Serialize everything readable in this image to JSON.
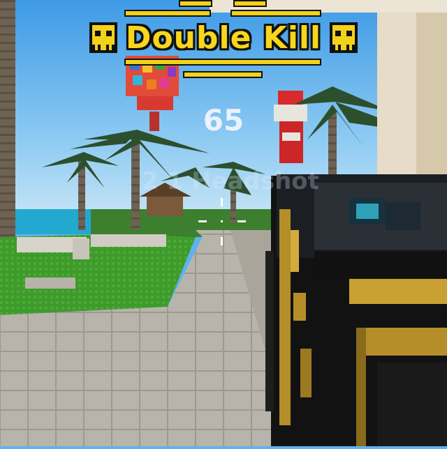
{
  "hud": {
    "kill_banner": "Double Kill",
    "score_popup": "65",
    "faded_label": "2 1 Headshot",
    "banner_color": "#f7d61c",
    "banner_outline": "#111111",
    "banner_icons": [
      "skull-icon",
      "skull-icon"
    ]
  },
  "crosshair": {
    "color": "#ffffff"
  }
}
